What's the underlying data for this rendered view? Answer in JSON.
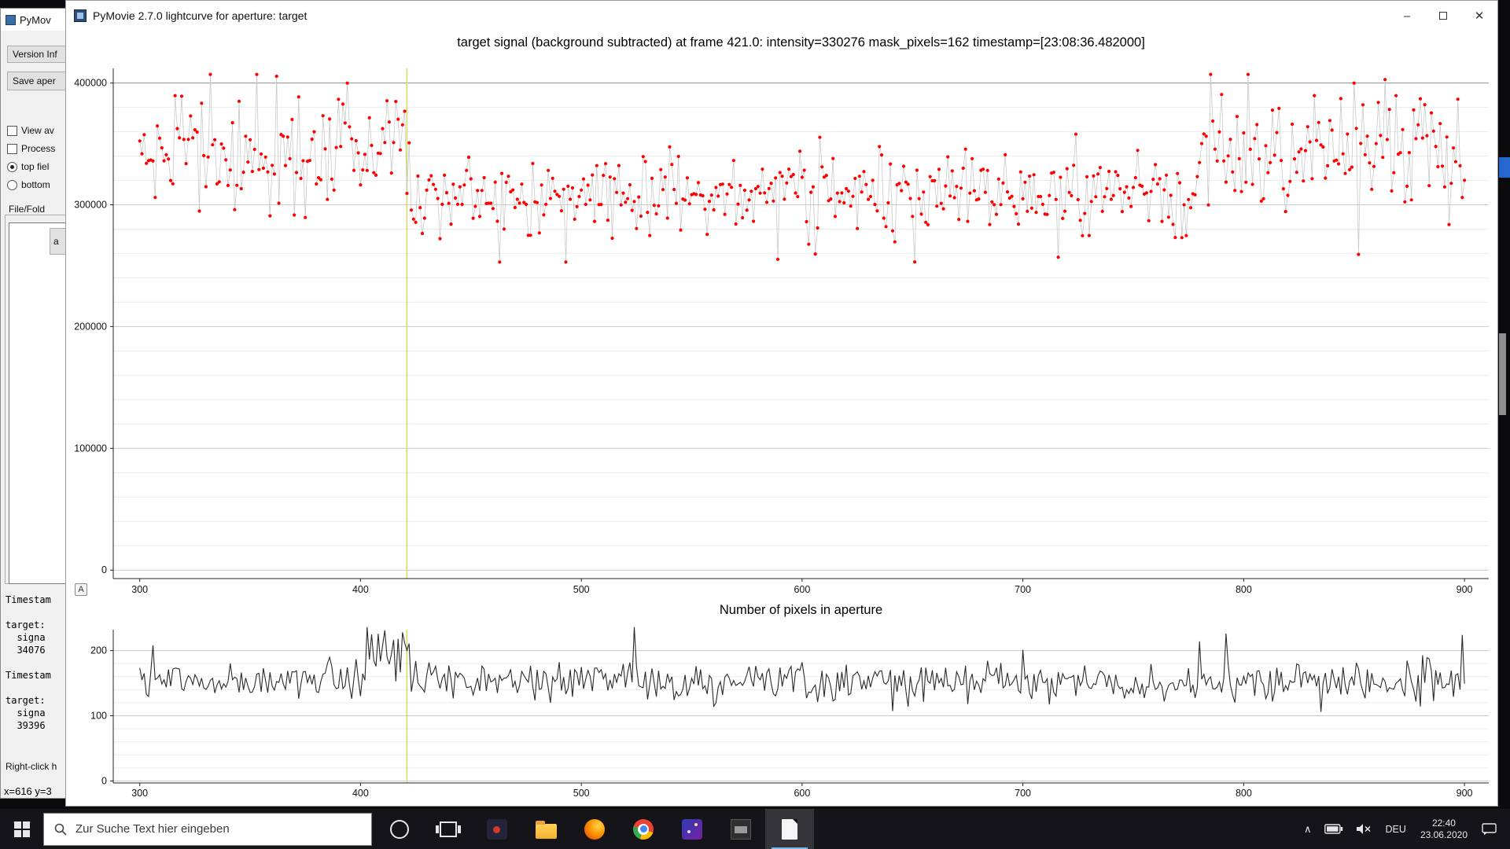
{
  "plot_window": {
    "title": "PyMovie 2.7.0 lightcurve for aperture: target",
    "autorange_label": "A"
  },
  "icons": {
    "minimize": "–",
    "maximize": "square-outline",
    "close": "✕",
    "search": "magnifier",
    "chevron_up": "∧"
  },
  "main_window": {
    "title": "PyMov",
    "button_version": "Version Inf",
    "button_save": "Save aper",
    "check_view": "View av",
    "check_process": "Process",
    "radio_top": "top fiel",
    "radio_bottom": "bottom",
    "group_label": "File/Fold",
    "mini_button": "a",
    "info_lines": [
      "Timestam",
      "",
      "target:",
      "  signa",
      "  34076",
      "",
      "Timestam",
      "",
      "target:",
      "  signa",
      "  39396"
    ],
    "hint": "Right-click h",
    "status": "x=616 y=3"
  },
  "taskbar": {
    "search_placeholder": "Zur Suche Text hier eingeben",
    "lang": "DEU",
    "time": "22:40",
    "date": "23.06.2020"
  },
  "colors": {
    "marker": "#ff0000",
    "cursor_line": "#d8d96e",
    "active_app_underline": "#76b9ed",
    "desktop_accent_blue": "#2667cf"
  },
  "chart_data": [
    {
      "type": "scatter",
      "title": "target signal (background subtracted) at frame 421.0: intensity=330276 mask_pixels=162 timestamp=[23:08:36.482000]",
      "x_ticks": [
        300,
        400,
        500,
        600,
        700,
        800,
        900
      ],
      "y_ticks": [
        0,
        100000,
        200000,
        300000,
        400000
      ],
      "xlim": [
        288,
        911
      ],
      "ylim": [
        -7000,
        412000
      ],
      "cursor_x": 421,
      "marker_color": "#ff0000",
      "connector_color": "#c9c9c9",
      "cursor_color": "#d8d96e",
      "x_step": 1,
      "segments": [
        {
          "x_start": 300,
          "x_end": 423,
          "mean": 346000,
          "std": 26000
        },
        {
          "x_start": 423,
          "x_end": 780,
          "mean": 309000,
          "std": 17000
        },
        {
          "x_start": 780,
          "x_end": 901,
          "mean": 347000,
          "std": 27000
        }
      ],
      "outlier_chance": 0.02,
      "outlier_drop": 42000,
      "clamp": [
        253000,
        407000
      ],
      "seed": 1234567
    },
    {
      "type": "line",
      "title": "Number of pixels in aperture",
      "x_ticks": [
        300,
        400,
        500,
        600,
        700,
        800,
        900
      ],
      "y_ticks": [
        0,
        100,
        200
      ],
      "xlim": [
        288,
        911
      ],
      "ylim": [
        -3,
        232
      ],
      "cursor_x": 421,
      "line_color": "#2a2a2a",
      "cursor_color": "#d8d96e",
      "x_step": 1,
      "segments": [
        {
          "x_start": 300,
          "x_end": 901,
          "mean": 152,
          "std": 15
        },
        {
          "x_start": 403,
          "x_end": 423,
          "mean": 200,
          "std": 18
        }
      ],
      "spikes": [
        {
          "x": 306,
          "y": 208
        },
        {
          "x": 411,
          "y": 231
        },
        {
          "x": 419,
          "y": 228
        },
        {
          "x": 524,
          "y": 236
        },
        {
          "x": 700,
          "y": 201
        },
        {
          "x": 780,
          "y": 214
        },
        {
          "x": 792,
          "y": 226
        },
        {
          "x": 899,
          "y": 224
        }
      ],
      "clamp": [
        106,
        236
      ],
      "seed": 424242
    }
  ]
}
